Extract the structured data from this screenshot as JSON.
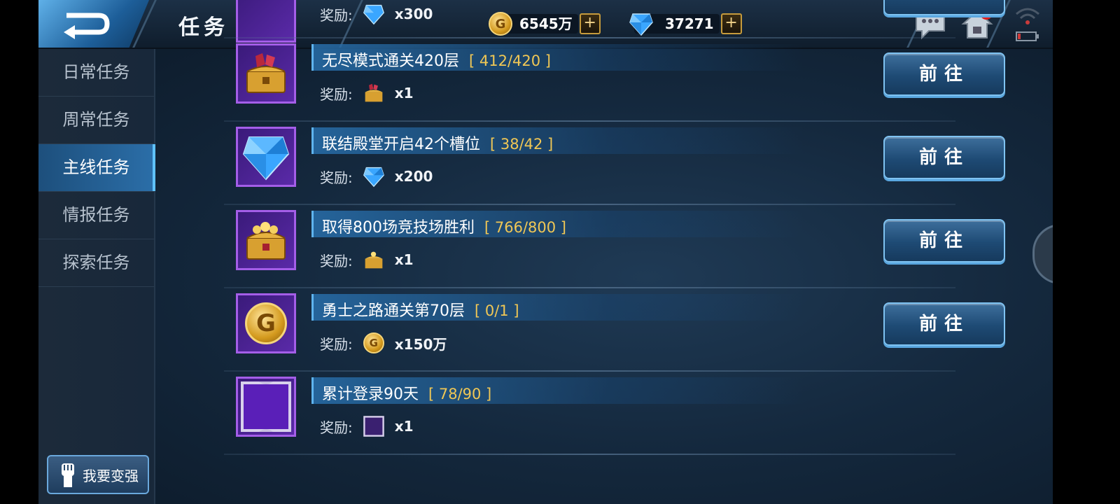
{
  "header": {
    "title": "任务",
    "gold": "6545万",
    "gems": "37271",
    "plus": "+",
    "mail_badge": "!"
  },
  "sidebar": {
    "items": [
      {
        "label": "日常任务",
        "active": false
      },
      {
        "label": "周常任务",
        "active": false
      },
      {
        "label": "主线任务",
        "active": true
      },
      {
        "label": "情报任务",
        "active": false
      },
      {
        "label": "探索任务",
        "active": false
      }
    ],
    "strong_button": "我要变强"
  },
  "tasks": [
    {
      "name": "",
      "progress": "",
      "reward_label": "奖励:",
      "reward_icon": "diamond-icon",
      "reward_amount": "x300",
      "button": ""
    },
    {
      "name": "无尽模式通关420层",
      "progress": "[ 412/420 ]",
      "reward_label": "奖励:",
      "reward_icon": "red-gem-chest-icon",
      "reward_amount": "x1",
      "button": "前往"
    },
    {
      "name": "联结殿堂开启42个槽位",
      "progress": "[ 38/42 ]",
      "reward_label": "奖励:",
      "reward_icon": "diamond-icon",
      "reward_amount": "x200",
      "button": "前往"
    },
    {
      "name": "取得800场竞技场胜利",
      "progress": "[ 766/800 ]",
      "reward_label": "奖励:",
      "reward_icon": "gold-chest-icon",
      "reward_amount": "x1",
      "button": "前往"
    },
    {
      "name": "勇士之路通关第70层",
      "progress": "[ 0/1 ]",
      "reward_label": "奖励:",
      "reward_icon": "gold-coin-icon",
      "reward_amount": "x150万",
      "button": "前往"
    },
    {
      "name": "累计登录90天",
      "progress": "[ 78/90 ]",
      "reward_label": "奖励:",
      "reward_icon": "avatar-frame-icon",
      "reward_amount": "x1",
      "button": ""
    }
  ],
  "colors": {
    "accent": "#5fb4ee",
    "progress": "#f0c755",
    "frame": "#a45ee8"
  }
}
